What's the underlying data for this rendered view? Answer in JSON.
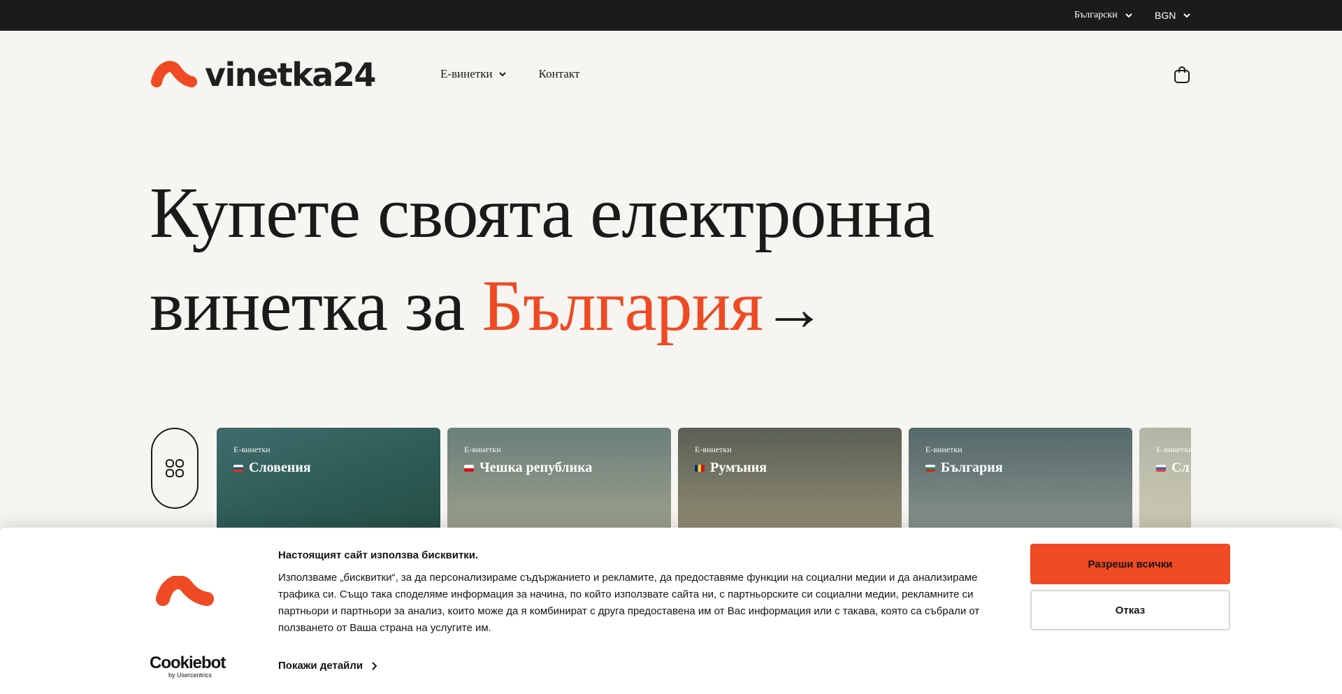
{
  "topbar": {
    "language": "Български",
    "currency": "BGN"
  },
  "header": {
    "logo_text": "vinetka24",
    "nav": [
      {
        "label": "Е-винетки",
        "has_dropdown": true
      },
      {
        "label": "Контакт",
        "has_dropdown": false
      }
    ],
    "cart_icon": "shopping-bag-icon"
  },
  "hero": {
    "line1": "Купете своята електронна",
    "line2_prefix": "винетка за ",
    "line2_accent": "България",
    "arrow": "→"
  },
  "carousel": {
    "grid_icon": "grid-icon",
    "cards": [
      {
        "label": "Е-винетки",
        "country": "Словения"
      },
      {
        "label": "Е-винетки",
        "country": "Чешка република"
      },
      {
        "label": "Е-винетки",
        "country": "Румъния"
      },
      {
        "label": "Е-винетки",
        "country": "България"
      },
      {
        "label": "Е-винетки",
        "country": "Сл"
      }
    ]
  },
  "cookie": {
    "title": "Настоящият сайт използва бисквитки.",
    "text": "Използваме „бисквитки“, за да персонализираме съдържанието и рекламите, да предоставяме функции на социални медии и да анализираме трафика си. Също така споделяме информация за начина, по който използвате сайта ни, с партньорските си социални медии, рекламните си партньори и партньори за анализ, които може да я комбинират с друга предоставена им от Вас информация или с такава, която са събрали от ползването от Ваша страна на услугите им.",
    "details_label": "Покажи детайли",
    "allow_label": "Разреши всички",
    "deny_label": "Отказ",
    "brand": "Cookiebot",
    "brand_sub": "by Usercentrics"
  },
  "colors": {
    "accent": "#ef4a23",
    "topbar": "#1b1b1b",
    "background": "#f6f5f1"
  }
}
